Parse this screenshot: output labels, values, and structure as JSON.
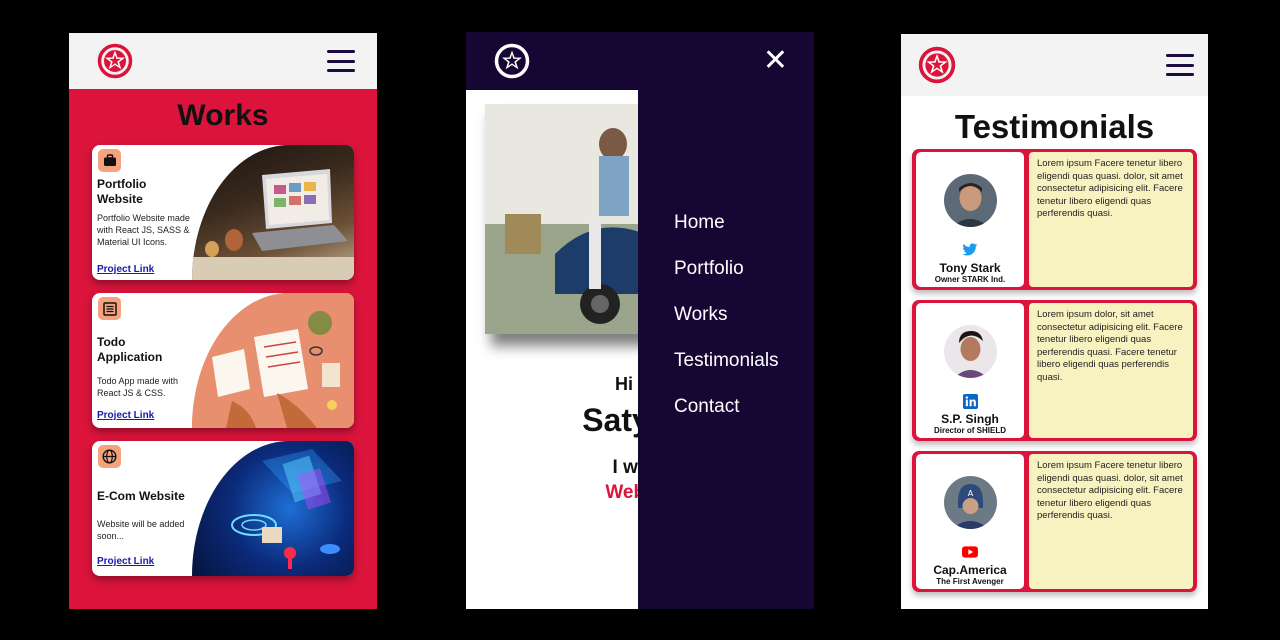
{
  "colors": {
    "crimson": "#dc143c",
    "navy": "#160634",
    "peach": "#f5a27e",
    "quote_bg": "#f8f2c0"
  },
  "works": {
    "title": "Works",
    "cards": [
      {
        "icon": "briefcase-icon",
        "title": "Portfolio Website",
        "desc": "Portfolio Website made with React JS, SASS & Material UI Icons.",
        "link": "Project Link"
      },
      {
        "icon": "list-icon",
        "title": "Todo Application",
        "desc": "Todo App made with React JS & CSS.",
        "link": "Project Link"
      },
      {
        "icon": "globe-icon",
        "title": "E-Com Website",
        "desc": "Website will be added soon...",
        "link": "Project Link"
      }
    ]
  },
  "hero": {
    "line1": "Hi the",
    "line2": "Satya P",
    "line3": "I work",
    "line4": "Web De"
  },
  "menu": {
    "items": [
      "Home",
      "Portfolio",
      "Works",
      "Testimonials",
      "Contact"
    ]
  },
  "testimonials": {
    "title": "Testimonials",
    "cards": [
      {
        "social_icon": "twitter-icon",
        "name": "Tony Stark",
        "role": "Owner STARK Ind.",
        "quote": "Lorem ipsum Facere tenetur libero eligendi quas quasi. dolor, sit amet consectetur adipisicing elit. Facere tenetur libero eligendi quas perferendis quasi."
      },
      {
        "social_icon": "linkedin-icon",
        "name": "S.P. Singh",
        "role": "Director of SHIELD",
        "quote": "Lorem ipsum dolor, sit amet consectetur adipisicing elit. Facere tenetur libero eligendi quas perferendis quasi. Facere tenetur libero eligendi quas perferendis quasi."
      },
      {
        "social_icon": "youtube-icon",
        "name": "Cap.America",
        "role": "The First Avenger",
        "quote": "Lorem ipsum Facere tenetur libero eligendi quas quasi. dolor, sit amet consectetur adipisicing elit. Facere tenetur libero eligendi quas perferendis quasi."
      }
    ]
  }
}
